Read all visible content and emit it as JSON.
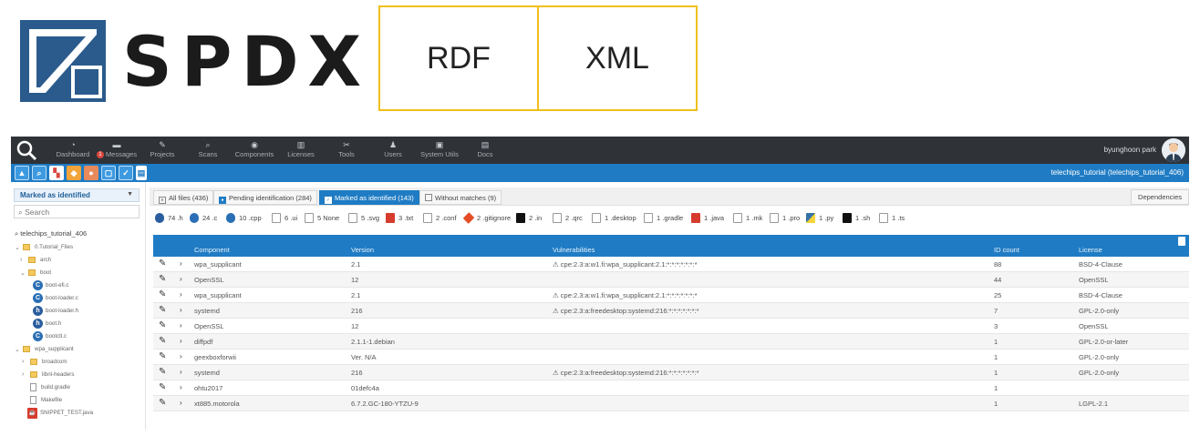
{
  "banner": {
    "logo_text": "SPDX",
    "formats": [
      "RDF",
      "XML"
    ],
    "colors": {
      "logo_blue": "#2b5b8c",
      "box_border": "#efc01a"
    }
  },
  "nav": {
    "items": [
      {
        "label": "Dashboard",
        "icon": "dashboard-icon"
      },
      {
        "label": "Messages",
        "icon": "comment-icon",
        "badge": "1"
      },
      {
        "label": "Projects",
        "icon": "pin-icon"
      },
      {
        "label": "Scans",
        "icon": "search-icon"
      },
      {
        "label": "Components",
        "icon": "cube-icon"
      },
      {
        "label": "Licenses",
        "icon": "trash-icon"
      },
      {
        "label": "Tools",
        "icon": "wrench-icon"
      },
      {
        "label": "Users",
        "icon": "user-icon"
      },
      {
        "label": "System Utils",
        "icon": "image-icon"
      },
      {
        "label": "Docs",
        "icon": "book-icon"
      }
    ],
    "user_name": "byunghoon park"
  },
  "subbar": {
    "project_title": "telechips_tutorial (telechips_tutorial_406)"
  },
  "sidebar": {
    "filter_label": "Marked as identified",
    "search_placeholder": "Search",
    "tree": [
      {
        "label": "telechips_tutorial_406",
        "type": "root"
      },
      {
        "label": "0.Tutorial_Files",
        "type": "folder",
        "open": true
      },
      {
        "label": "arch",
        "type": "folder",
        "open": false
      },
      {
        "label": "boot",
        "type": "folder",
        "open": true
      },
      {
        "label": "boot-efi.c",
        "type": "c"
      },
      {
        "label": "boot-loader.c",
        "type": "c"
      },
      {
        "label": "boot-loader.h",
        "type": "h"
      },
      {
        "label": "boot.h",
        "type": "h"
      },
      {
        "label": "bootctl.c",
        "type": "c"
      },
      {
        "label": "wpa_supplicant",
        "type": "folder",
        "open": true
      },
      {
        "label": "broadcom",
        "type": "folder",
        "open": false
      },
      {
        "label": "libnl-headers",
        "type": "folder",
        "open": false
      },
      {
        "label": "build.gradle",
        "type": "file"
      },
      {
        "label": "Makefile",
        "type": "file"
      },
      {
        "label": "SNIPPET_TEST.java",
        "type": "java"
      }
    ]
  },
  "tabs": [
    {
      "label": "All files",
      "count": "(436)"
    },
    {
      "label": "Pending identification",
      "count": "(284)"
    },
    {
      "label": "Marked as identified",
      "count": "(143)",
      "active": true
    },
    {
      "label": "Without matches",
      "count": "(9)"
    }
  ],
  "dependencies_label": "Dependencies",
  "file_types": [
    {
      "count": "74",
      "ext": ".h",
      "icon": "h-icon"
    },
    {
      "count": "24",
      "ext": ".c",
      "icon": "c-icon"
    },
    {
      "count": "10",
      "ext": ".cpp",
      "icon": "c-icon"
    },
    {
      "count": "6",
      "ext": ".ui",
      "icon": "file-icon"
    },
    {
      "count": "5",
      "ext": "None",
      "icon": "file-icon"
    },
    {
      "count": "5",
      "ext": ".svg",
      "icon": "file-icon"
    },
    {
      "count": "3",
      "ext": ".txt",
      "icon": "txt-icon"
    },
    {
      "count": "2",
      "ext": ".conf",
      "icon": "file-icon"
    },
    {
      "count": "2",
      "ext": ".gitignore",
      "icon": "git-icon"
    },
    {
      "count": "2",
      "ext": ".in",
      "icon": "terminal-icon"
    },
    {
      "count": "2",
      "ext": ".qrc",
      "icon": "file-icon"
    },
    {
      "count": "1",
      "ext": ".desktop",
      "icon": "file-icon"
    },
    {
      "count": "1",
      "ext": ".gradle",
      "icon": "file-icon"
    },
    {
      "count": "1",
      "ext": ".java",
      "icon": "java-icon"
    },
    {
      "count": "1",
      "ext": ".mk",
      "icon": "file-icon"
    },
    {
      "count": "1",
      "ext": ".pro",
      "icon": "file-icon"
    },
    {
      "count": "1",
      "ext": ".py",
      "icon": "python-icon"
    },
    {
      "count": "1",
      "ext": ".sh",
      "icon": "terminal-icon"
    },
    {
      "count": "1",
      "ext": ".ts",
      "icon": "file-icon"
    }
  ],
  "table": {
    "headers": [
      "Component",
      "Version",
      "Vulnerabilities",
      "ID count",
      "License"
    ],
    "rows": [
      {
        "component": "wpa_supplicant",
        "version": "2.1",
        "vuln": "⚠ cpe:2.3:a:w1.fi:wpa_supplicant:2.1:*:*:*:*:*:*:*",
        "id_count": "88",
        "license": "BSD-4-Clause"
      },
      {
        "component": "OpenSSL",
        "version": "12",
        "vuln": "",
        "id_count": "44",
        "license": "OpenSSL"
      },
      {
        "component": "wpa_supplicant",
        "version": "2.1",
        "vuln": "⚠ cpe:2.3:a:w1.fi:wpa_supplicant:2.1:*:*:*:*:*:*:*",
        "id_count": "25",
        "license": "BSD-4-Clause"
      },
      {
        "component": "systemd",
        "version": "216",
        "vuln": "⚠ cpe:2.3:a:freedesktop:systemd:216:*:*:*:*:*:*:*",
        "id_count": "7",
        "license": "GPL-2.0-only"
      },
      {
        "component": "OpenSSL",
        "version": "12",
        "vuln": "",
        "id_count": "3",
        "license": "OpenSSL"
      },
      {
        "component": "diffpdf",
        "version": "2.1.1-1.debian",
        "vuln": "",
        "id_count": "1",
        "license": "GPL-2.0-or-later"
      },
      {
        "component": "geexboxforwii",
        "version": "Ver. N/A",
        "vuln": "",
        "id_count": "1",
        "license": "GPL-2.0-only"
      },
      {
        "component": "systemd",
        "version": "216",
        "vuln": "⚠ cpe:2.3:a:freedesktop:systemd:216:*:*:*:*:*:*:*",
        "id_count": "1",
        "license": "GPL-2.0-only"
      },
      {
        "component": "ohtu2017",
        "version": "01defc4a",
        "vuln": "",
        "id_count": "1",
        "license": ""
      },
      {
        "component": "xt885.motorola",
        "version": "6.7.2.GC-180-YTZU-9",
        "vuln": "",
        "id_count": "1",
        "license": "LGPL-2.1"
      }
    ]
  },
  "colors": {
    "nav_bg": "#2f3338",
    "accent_blue": "#1f7cc4"
  }
}
